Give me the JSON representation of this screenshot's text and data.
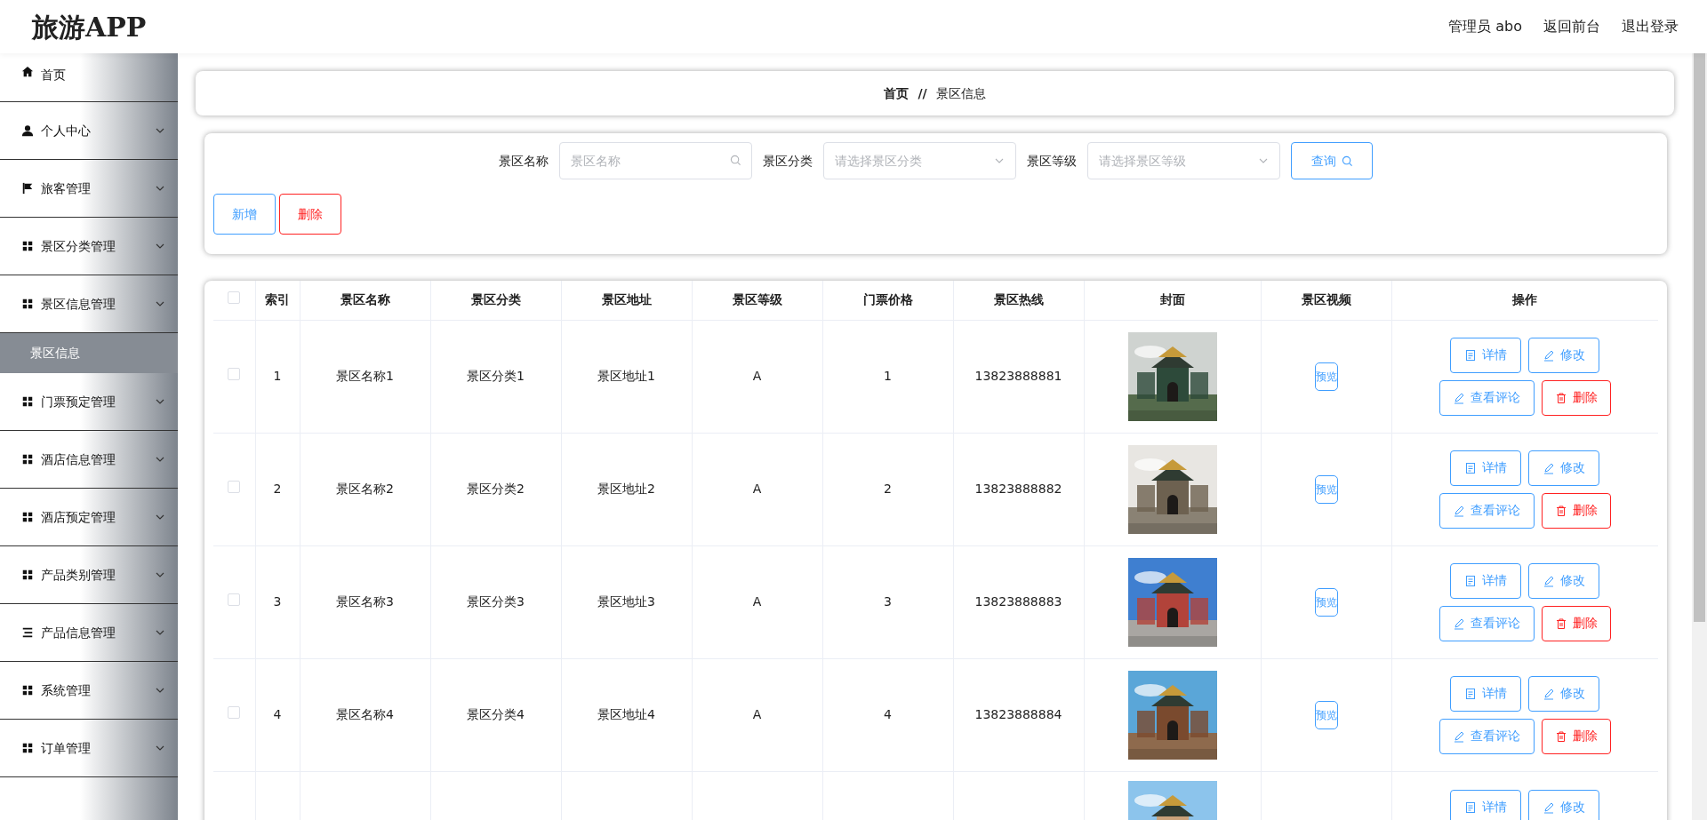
{
  "header": {
    "logo": "旅游APP",
    "links": [
      "管理员 abo",
      "返回前台",
      "退出登录"
    ]
  },
  "sidebar": {
    "items": [
      {
        "label": "首页",
        "kind": "link"
      },
      {
        "label": "个人中心",
        "kind": "menu"
      },
      {
        "label": "旅客管理",
        "kind": "menu"
      },
      {
        "label": "景区分类管理",
        "kind": "menu"
      },
      {
        "label": "景区信息管理",
        "kind": "menu",
        "children": [
          {
            "label": "景区信息",
            "selected": true
          }
        ]
      },
      {
        "label": "门票预定管理",
        "kind": "menu"
      },
      {
        "label": "酒店信息管理",
        "kind": "menu"
      },
      {
        "label": "酒店预定管理",
        "kind": "menu"
      },
      {
        "label": "产品类别管理",
        "kind": "menu"
      },
      {
        "label": "产品信息管理",
        "kind": "menu"
      },
      {
        "label": "系统管理",
        "kind": "menu"
      },
      {
        "label": "订单管理",
        "kind": "menu"
      }
    ]
  },
  "breadcrumb": {
    "items": [
      "首页",
      "景区信息"
    ],
    "separator": "//"
  },
  "search": {
    "fields": [
      {
        "label": "景区名称",
        "placeholder": "景区名称",
        "kind": "input"
      },
      {
        "label": "景区分类",
        "placeholder": "请选择景区分类",
        "kind": "select"
      },
      {
        "label": "景区等级",
        "placeholder": "请选择景区等级",
        "kind": "select"
      }
    ],
    "query_button": "查询",
    "actions": [
      {
        "label": "新增",
        "kind": "primary"
      },
      {
        "label": "删除",
        "kind": "danger"
      }
    ]
  },
  "table": {
    "all_checked": false,
    "columns": [
      "索引",
      "景区名称",
      "景区分类",
      "景区地址",
      "景区等级",
      "门票价格",
      "景区热线",
      "封面",
      "景区视频",
      "操作"
    ],
    "rows": [
      {
        "checked": false,
        "index": "1",
        "name": "景区名称1",
        "category": "景区分类1",
        "address": "景区地址1",
        "grade": "A",
        "price": "1",
        "hotline": "13823888881",
        "cover": {
          "kind": "picture"
        },
        "video": "预览",
        "actions": [
          {
            "label": "详情",
            "kind": "detail"
          },
          {
            "label": "修改",
            "kind": "edit"
          },
          {
            "label": "查看评论",
            "kind": "comment"
          },
          {
            "label": "删除",
            "kind": "delete"
          }
        ]
      },
      {
        "checked": false,
        "index": "2",
        "name": "景区名称2",
        "category": "景区分类2",
        "address": "景区地址2",
        "grade": "A",
        "price": "2",
        "hotline": "13823888882",
        "cover": {
          "kind": "picture"
        },
        "video": "预览",
        "actions": [
          {
            "label": "详情",
            "kind": "detail"
          },
          {
            "label": "修改",
            "kind": "edit"
          },
          {
            "label": "查看评论",
            "kind": "comment"
          },
          {
            "label": "删除",
            "kind": "delete"
          }
        ]
      },
      {
        "checked": false,
        "index": "3",
        "name": "景区名称3",
        "category": "景区分类3",
        "address": "景区地址3",
        "grade": "A",
        "price": "3",
        "hotline": "13823888883",
        "cover": {
          "kind": "picture"
        },
        "video": "预览",
        "actions": [
          {
            "label": "详情",
            "kind": "detail"
          },
          {
            "label": "修改",
            "kind": "edit"
          },
          {
            "label": "查看评论",
            "kind": "comment"
          },
          {
            "label": "删除",
            "kind": "delete"
          }
        ]
      },
      {
        "checked": false,
        "index": "4",
        "name": "景区名称4",
        "category": "景区分类4",
        "address": "景区地址4",
        "grade": "A",
        "price": "4",
        "hotline": "13823888884",
        "cover": {
          "kind": "picture"
        },
        "video": "预览",
        "actions": [
          {
            "label": "详情",
            "kind": "detail"
          },
          {
            "label": "修改",
            "kind": "edit"
          },
          {
            "label": "查看评论",
            "kind": "comment"
          },
          {
            "label": "删除",
            "kind": "delete"
          }
        ]
      },
      {
        "cover": {
          "kind": "picture"
        },
        "actions": [
          {
            "label": "详情",
            "kind": "detail"
          },
          {
            "label": "修改",
            "kind": "edit"
          }
        ]
      }
    ]
  }
}
